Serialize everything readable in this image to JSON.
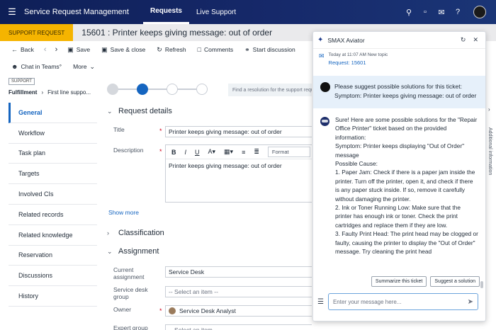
{
  "header": {
    "app_title": "Service Request Management",
    "tabs": [
      {
        "label": "Requests",
        "active": true
      },
      {
        "label": "Live Support",
        "active": false
      }
    ],
    "icons": [
      "search-icon",
      "chat-icon",
      "message-icon",
      "help-icon",
      "avatar"
    ]
  },
  "record": {
    "badge": "SUPPORT REQUEST",
    "title": "15601 : Printer keeps giving message: out of order"
  },
  "toolbar": {
    "back": "Back",
    "save": "Save",
    "save_close": "Save & close",
    "refresh": "Refresh",
    "comments": "Comments",
    "start_discussion": "Start discussion",
    "chat_teams": "Chat in Teams°",
    "more": "More"
  },
  "leftnav": {
    "tag": "SUPPORT",
    "crumb_phase": "Fulfillment",
    "crumb_next": "First line suppo...",
    "items": [
      {
        "label": "General",
        "active": true
      },
      {
        "label": "Workflow"
      },
      {
        "label": "Task plan"
      },
      {
        "label": "Targets"
      },
      {
        "label": "Involved CIs"
      },
      {
        "label": "Related records"
      },
      {
        "label": "Related knowledge"
      },
      {
        "label": "Reservation"
      },
      {
        "label": "Discussions"
      },
      {
        "label": "History"
      }
    ]
  },
  "form": {
    "hint": "Find a resolution for the support request",
    "request_details": "Request details",
    "title_label": "Title",
    "title_value": "Printer keeps giving message: out of order",
    "description_label": "Description",
    "format_label": "Format",
    "description_value": "Printer keeps giving message: out of order",
    "show_more": "Show more",
    "classification": "Classification",
    "assignment": "Assignment",
    "current_assignment_label": "Current assignment",
    "current_assignment_value": "Service Desk",
    "service_desk_group_label": "Service desk group",
    "service_desk_group_placeholder": "-- Select an item --",
    "owner_label": "Owner",
    "owner_value": "Service Desk Analyst",
    "expert_group_label": "Expert group",
    "expert_group_placeholder": "-- Select an item --"
  },
  "aviator": {
    "title": "SMAX Aviator",
    "timestamp": "Today at 11:07 AM New topic",
    "request_link": "Request: 15601",
    "user_message_line1": "Please suggest possible solutions for this ticket:",
    "user_message_line2": "Symptom: Printer keeps giving message: out of order",
    "bot_lines": [
      "Sure! Here are some possible solutions for the \"Repair Office Printer\" ticket based on the provided information:",
      "Symptom: Printer keeps displaying \"Out of Order\" message",
      "Possible Cause:",
      "1. Paper Jam: Check if there is a paper jam inside the printer. Turn off the printer, open it, and check if there is any paper stuck inside. If so, remove it carefully without damaging the printer.",
      "2. Ink or Toner Running Low: Make sure that the printer has enough ink or toner. Check the print cartridges and replace them if they are low.",
      "3. Faulty Print Head: The print head may be clogged or faulty, causing the printer to display the \"Out of Order\" message. Try cleaning the print head"
    ],
    "suggestion_1": "Summarize this ticket",
    "suggestion_2": "Suggest a solution",
    "input_placeholder": "Enter your message here..."
  },
  "right_edge_text": "Additional information"
}
